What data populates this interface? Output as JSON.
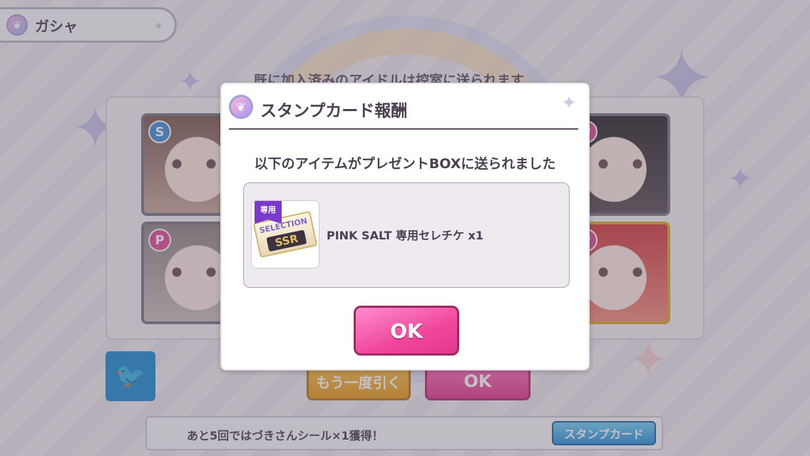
{
  "header": {
    "title": "ガシャ",
    "icon": "gacha-icon"
  },
  "notice": "既に加入済みのアイドルは控室に送られます",
  "cards": [
    {
      "badge": "S",
      "badge_color": "#3f8fd6",
      "frame": "silver"
    },
    {
      "badge": "P",
      "badge_color": "#e24b9a",
      "frame": "silver"
    },
    {
      "badge": "P",
      "badge_color": "#e24b9a",
      "frame": "silver"
    },
    {
      "badge": "P",
      "badge_color": "#e24b9a",
      "frame": "gold"
    }
  ],
  "actions": {
    "twitter_icon": "twitter-icon",
    "again_label": "もう一度引く",
    "ok_label": "OK"
  },
  "bottom_bar": {
    "message": "あと5回ではづきさんシール×1獲得！",
    "stamp_button": "スタンプカード"
  },
  "dialog": {
    "title": "スタンプカード報酬",
    "message": "以下のアイテムがプレゼントBOXに送られました",
    "item": {
      "tag": "専用",
      "ticket_top": "SELECTION",
      "ticket_rank": "SSR",
      "name": "PINK SALT 専用セレチケ x1"
    },
    "ok_label": "OK"
  },
  "colors": {
    "accent_pink": "#f0479c",
    "twitter_blue": "#1e8bd4",
    "gold_button": "#f7c04a"
  }
}
